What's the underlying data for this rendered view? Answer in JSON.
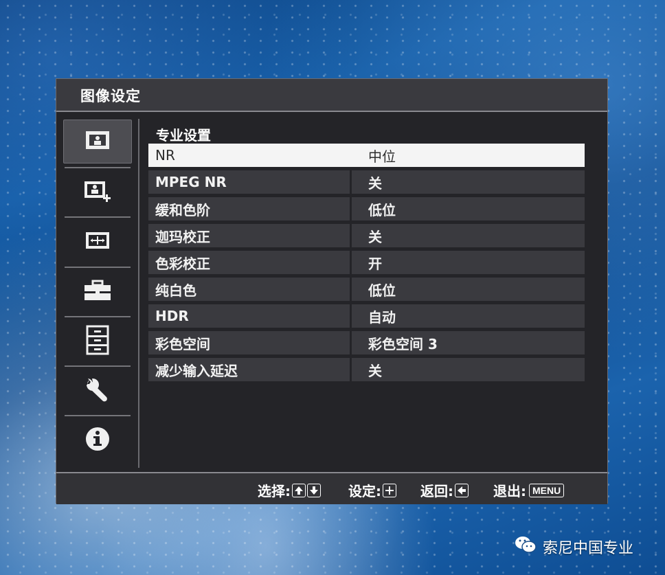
{
  "osd": {
    "title": "图像设定",
    "section_title": "专业设置",
    "sidebar": [
      {
        "name": "picture-icon",
        "selected": true
      },
      {
        "name": "picture-plus-icon",
        "selected": false
      },
      {
        "name": "screen-adjust-icon",
        "selected": false
      },
      {
        "name": "toolbox-icon",
        "selected": false
      },
      {
        "name": "cabinet-icon",
        "selected": false
      },
      {
        "name": "wrench-icon",
        "selected": false
      },
      {
        "name": "info-icon",
        "selected": false
      }
    ],
    "rows": [
      {
        "label": "NR",
        "value": "中位",
        "selected": true
      },
      {
        "label": "MPEG NR",
        "value": "关"
      },
      {
        "label": "缓和色阶",
        "value": "低位"
      },
      {
        "label": "迦玛校正",
        "value": "关"
      },
      {
        "label": "色彩校正",
        "value": "开"
      },
      {
        "label": "纯白色",
        "value": "低位"
      },
      {
        "label": "HDR",
        "value": "自动"
      },
      {
        "label": "彩色空间",
        "value": "彩色空间 3"
      },
      {
        "label": "减少输入延迟",
        "value": "关"
      }
    ],
    "footer": {
      "select_label": "选择:",
      "set_label": "设定:",
      "back_label": "返回:",
      "exit_label": "退出:",
      "menu_key": "MENU"
    }
  },
  "watermark": {
    "text": "索尼中国专业"
  }
}
